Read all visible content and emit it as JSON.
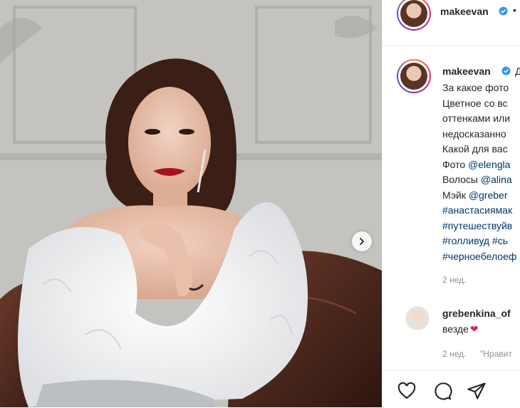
{
  "post": {
    "username": "makeevan",
    "header_dot": "•"
  },
  "caption": {
    "username": "makeevan",
    "lines": [
      {
        "text": "Д",
        "kind": "inline"
      },
      {
        "text": "За какое фото"
      },
      {
        "text": "Цветное со вс"
      },
      {
        "text": "оттенками или"
      },
      {
        "text": "недосказанно"
      },
      {
        "text": "Какой для вас"
      },
      {
        "prefix": "Фото ",
        "link": "@elengla"
      },
      {
        "prefix": "Волосы ",
        "link": "@alina"
      },
      {
        "prefix": "Мэйк ",
        "link": "@greber"
      },
      {
        "link": "#анастасиямак"
      },
      {
        "link": "#путешествуйв"
      },
      {
        "link": "#голливуд",
        "suffix_link": " #сь"
      },
      {
        "link": "#черноебелоеф"
      }
    ],
    "time": "2 нед."
  },
  "comment": {
    "username": "grebenkina_of",
    "text": "везде",
    "heart": "❤",
    "time": "2 нед.",
    "like_link": "\"Нравит"
  },
  "colors": {
    "link": "#00376b",
    "heart": "#e0245e",
    "verified": "#3897f0"
  },
  "icons": [
    "next-arrow-icon",
    "verified-icon",
    "heart-icon",
    "comment-icon",
    "share-icon"
  ]
}
